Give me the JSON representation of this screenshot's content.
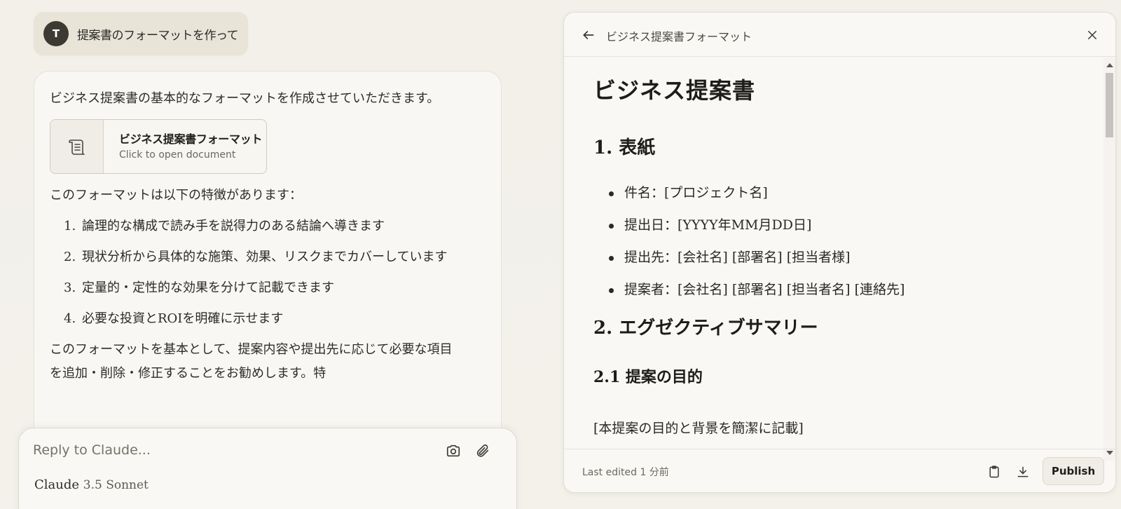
{
  "user_message": {
    "avatar_initial": "T",
    "text": "提案書のフォーマットを作って"
  },
  "assistant_message": {
    "intro": "ビジネス提案書の基本的なフォーマットを作成させていただきます。",
    "artifact_card": {
      "title": "ビジネス提案書フォーマット",
      "subtitle": "Click to open document",
      "icon": "scroll-document-icon"
    },
    "features_intro": "このフォーマットは以下の特徴があります：",
    "features": [
      {
        "num": "1.",
        "text": "論理的な構成で読み手を説得力のある結論へ導きます"
      },
      {
        "num": "2.",
        "text": "現状分析から具体的な施策、効果、リスクまでカバーしています"
      },
      {
        "num": "3.",
        "text": "定量的・定性的な効果を分けて記載できます"
      },
      {
        "num": "4.",
        "text": "必要な投資とROIを明確に示せます"
      }
    ],
    "closing": "このフォーマットを基本として、提案内容や提出先に応じて必要な項目を追加・削除・修正することをお勧めします。特"
  },
  "reply": {
    "placeholder": "Reply to Claude...",
    "model_name": "Claude",
    "model_version": "3.5 Sonnet"
  },
  "artifact_panel": {
    "header_title": "ビジネス提案書フォーマット",
    "doc": {
      "h1": "ビジネス提案書",
      "section1_title": "1. 表紙",
      "section1_items": [
        "件名：[プロジェクト名]",
        "提出日：[YYYY年MM月DD日]",
        "提出先：[会社名] [部署名] [担当者様]",
        "提案者：[会社名] [部署名] [担当者名] [連絡先]"
      ],
      "section2_title": "2. エグゼクティブサマリー",
      "section21_title": "2.1 提案の目的",
      "section21_body": "[本提案の目的と背景を簡潔に記載]"
    },
    "footer": {
      "last_edited": "Last edited 1 分前",
      "publish_label": "Publish"
    }
  }
}
